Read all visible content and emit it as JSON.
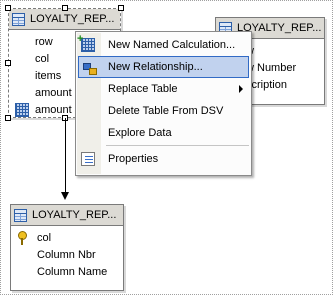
{
  "tables": {
    "loyalty_a": {
      "title": "LOYALTY_REP...",
      "columns": [
        "row",
        "col",
        "items",
        "amount",
        "amount c"
      ]
    },
    "loyalty_b": {
      "title": "LOYALTY_REP...",
      "columns": [
        "w",
        "w Number",
        "scription"
      ]
    },
    "loyalty_c": {
      "title": "LOYALTY_REP...",
      "columns": [
        "col",
        "Column Nbr",
        "Column Name"
      ]
    }
  },
  "context_menu": {
    "items": [
      {
        "label": "New Named Calculation...",
        "icon": "named-calculation-icon"
      },
      {
        "label": "New Relationship...",
        "icon": "relationship-icon",
        "highlighted": true
      },
      {
        "label": "Replace Table",
        "has_submenu": true
      },
      {
        "label": "Delete Table From DSV"
      },
      {
        "label": "Explore Data"
      },
      {
        "label": "Properties",
        "icon": "properties-icon"
      }
    ]
  },
  "colors": {
    "header_bg": "#dcdad4",
    "menu_highlight": "#c1d2ee",
    "menu_highlight_border": "#316ac5",
    "icon_blue": "#2d5fa8"
  }
}
